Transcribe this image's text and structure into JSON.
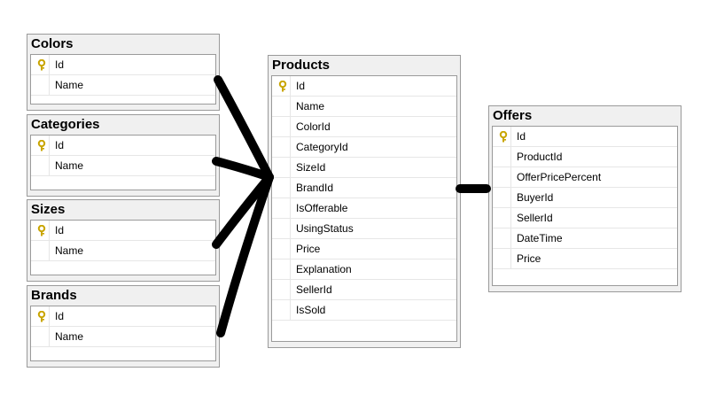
{
  "tables": {
    "colors": {
      "title": "Colors",
      "columns": [
        "Id",
        "Name"
      ]
    },
    "categories": {
      "title": "Categories",
      "columns": [
        "Id",
        "Name"
      ]
    },
    "sizes": {
      "title": "Sizes",
      "columns": [
        "Id",
        "Name"
      ]
    },
    "brands": {
      "title": "Brands",
      "columns": [
        "Id",
        "Name"
      ]
    },
    "products": {
      "title": "Products",
      "columns": [
        "Id",
        "Name",
        "ColorId",
        "CategoryId",
        "SizeId",
        "BrandId",
        "IsOfferable",
        "UsingStatus",
        "Price",
        "Explanation",
        "SellerId",
        "IsSold"
      ]
    },
    "offers": {
      "title": "Offers",
      "columns": [
        "Id",
        "ProductId",
        "OfferPricePercent",
        "BuyerId",
        "SellerId",
        "DateTime",
        "Price"
      ]
    }
  },
  "icons": {
    "primary_key": "key-icon"
  },
  "colors": {
    "line": "#000000",
    "key": "#e8c20a"
  }
}
